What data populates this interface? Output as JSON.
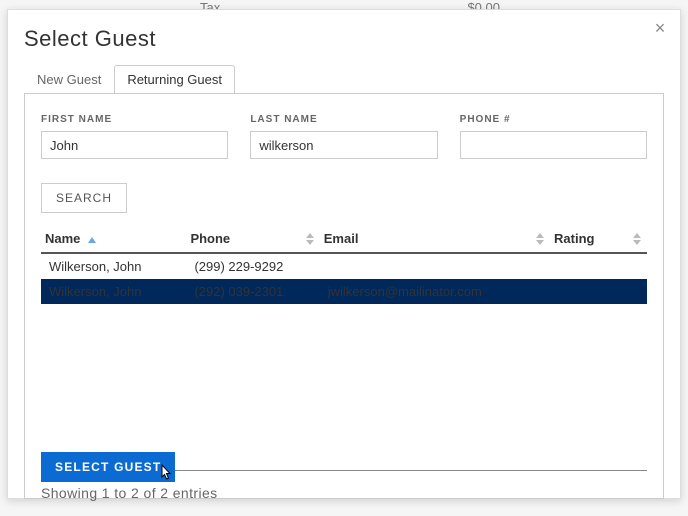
{
  "background": {
    "tax_label": "Tax",
    "tax_value": "$0.00"
  },
  "modal": {
    "title": "Select Guest",
    "close_glyph": "×",
    "tabs": {
      "new": "New Guest",
      "returning": "Returning Guest",
      "active": "returning"
    },
    "fields": {
      "first_name": {
        "label": "FIRST NAME",
        "value": "John",
        "placeholder": ""
      },
      "last_name": {
        "label": "LAST NAME",
        "value": "wilkerson",
        "placeholder": ""
      },
      "phone": {
        "label": "PHONE #",
        "value": "",
        "placeholder": ""
      }
    },
    "search_label": "SEARCH",
    "columns": {
      "name": "Name",
      "phone": "Phone",
      "email": "Email",
      "rating": "Rating"
    },
    "rows": [
      {
        "name": "Wilkerson, John",
        "phone": "(299) 229-9292",
        "email": "",
        "rating": "",
        "selected": false
      },
      {
        "name": "Wilkerson, John",
        "phone": "(292) 039-2301",
        "email": "jwilkerson@mailinator.com",
        "rating": "",
        "selected": true
      }
    ],
    "entries_info": "Showing 1 to 2 of 2 entries",
    "select_guest_label": "SELECT GUEST"
  }
}
